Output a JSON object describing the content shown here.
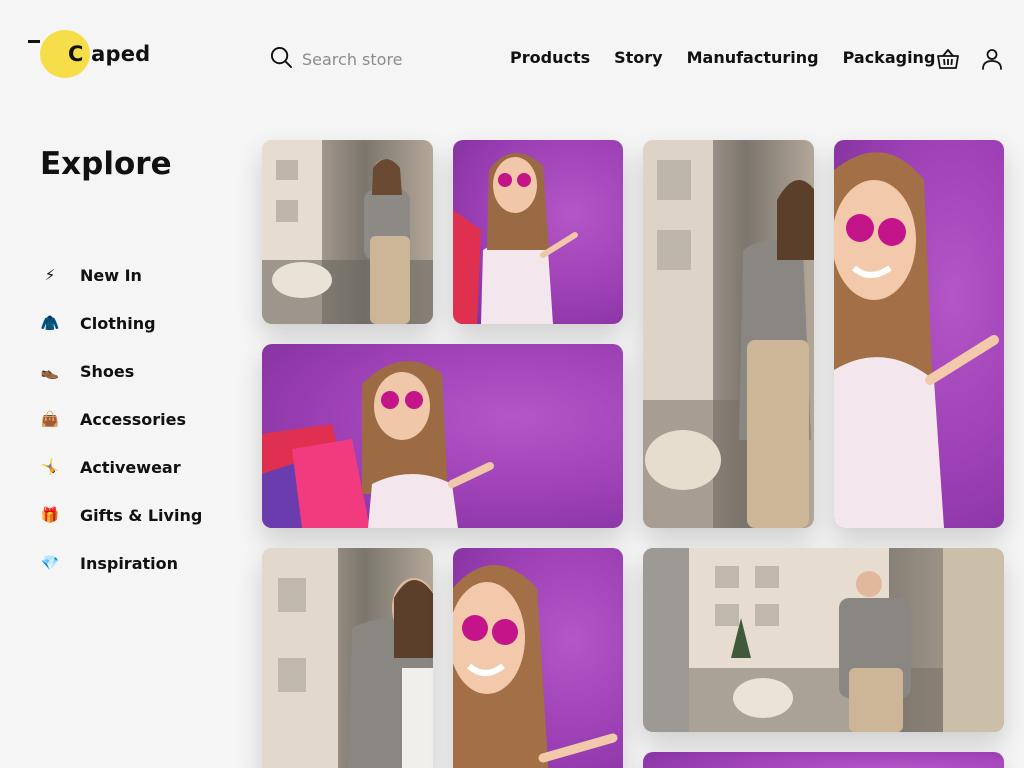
{
  "header": {
    "logo_text": "aped",
    "logo_letter": "C",
    "search_placeholder": "Search store",
    "nav": [
      "Products",
      "Story",
      "Manufacturing",
      "Packaging"
    ],
    "icons": [
      "search-icon",
      "basket-icon",
      "user-icon"
    ]
  },
  "sidebar": {
    "title": "Explore",
    "items": [
      {
        "label": "New In",
        "icon": "lightning-icon",
        "glyph": "⚡"
      },
      {
        "label": "Clothing",
        "icon": "coat-icon",
        "glyph": "🧥"
      },
      {
        "label": "Shoes",
        "icon": "shoe-icon",
        "glyph": "👞"
      },
      {
        "label": "Accessories",
        "icon": "handbag-icon",
        "glyph": "👜"
      },
      {
        "label": "Activewear",
        "icon": "gymnast-icon",
        "glyph": "🤸"
      },
      {
        "label": "Gifts & Living",
        "icon": "gift-icon",
        "glyph": "🎁"
      },
      {
        "label": "Inspiration",
        "icon": "gem-icon",
        "glyph": "💎"
      }
    ]
  },
  "gallery": {
    "photos": [
      {
        "subject": "woman-street-glasses"
      },
      {
        "subject": "woman-shopping-bags-purple"
      },
      {
        "subject": "woman-street-portrait"
      },
      {
        "subject": "woman-pointing-purple"
      },
      {
        "subject": "woman-shopping-bags-purple-wide"
      },
      {
        "subject": "woman-street-closeup"
      },
      {
        "subject": "woman-smiling-purple"
      },
      {
        "subject": "woman-street-wide"
      },
      {
        "subject": "purple-partial"
      }
    ]
  },
  "colors": {
    "background": "#f5f5f5",
    "logo_accent": "#f6de4a",
    "photo_purple": "#9b3fb4",
    "text": "#111111"
  }
}
